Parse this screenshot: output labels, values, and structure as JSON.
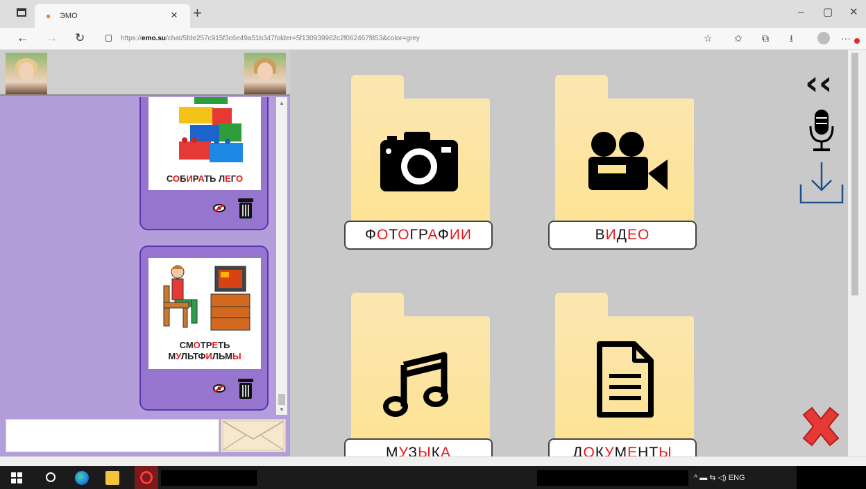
{
  "browser": {
    "tab_title": "ЭМО",
    "url_prefix": "https://",
    "url_domain": "emo.su",
    "url_path": "/chat/5fde257c915f3c6e49a51b347folder=5f130939962c2f062467f853&color=grey",
    "tab_close": "×",
    "new_tab": "+",
    "window": {
      "minimize": "–",
      "maximize": "▢",
      "close": "✕"
    },
    "nav": {
      "back": "←",
      "forward": "→",
      "reload": "↻"
    },
    "toolbar_icons": {
      "reading": "☆",
      "favorites": "✩",
      "collections": "⧉",
      "downloads": "⭳",
      "more": "···"
    }
  },
  "left_panel": {
    "cards": [
      {
        "label_parts": [
          {
            "t": "С",
            "r": false
          },
          {
            "t": "О",
            "r": true
          },
          {
            "t": "Б",
            "r": false
          },
          {
            "t": "И",
            "r": true
          },
          {
            "t": "Р",
            "r": false
          },
          {
            "t": "А",
            "r": true
          },
          {
            "t": "ТЬ Л",
            "r": false
          },
          {
            "t": "Е",
            "r": true
          },
          {
            "t": "Г",
            "r": false
          },
          {
            "t": "О",
            "r": true
          }
        ]
      },
      {
        "label_line1": [
          {
            "t": "СМ",
            "r": false
          },
          {
            "t": "О",
            "r": true
          },
          {
            "t": "ТР",
            "r": false
          },
          {
            "t": "Е",
            "r": true
          },
          {
            "t": "ТЬ",
            "r": false
          }
        ],
        "label_line2": [
          {
            "t": "М",
            "r": false
          },
          {
            "t": "У",
            "r": true
          },
          {
            "t": "ЛЬТФ",
            "r": false
          },
          {
            "t": "И",
            "r": true
          },
          {
            "t": "ЛЬМ",
            "r": false
          },
          {
            "t": "Ы",
            "r": true
          }
        ]
      }
    ]
  },
  "folders": [
    {
      "icon": "camera-icon",
      "label_parts": [
        {
          "t": "Ф",
          "r": false
        },
        {
          "t": "О",
          "r": true
        },
        {
          "t": "Т",
          "r": false
        },
        {
          "t": "О",
          "r": true
        },
        {
          "t": "ГР",
          "r": false
        },
        {
          "t": "А",
          "r": true
        },
        {
          "t": "Ф",
          "r": false
        },
        {
          "t": "ИИ",
          "r": true
        }
      ]
    },
    {
      "icon": "video-camera-icon",
      "label_parts": [
        {
          "t": "В",
          "r": false
        },
        {
          "t": "И",
          "r": true
        },
        {
          "t": "Д",
          "r": false
        },
        {
          "t": "Е",
          "r": true
        },
        {
          "t": "О",
          "r": true
        }
      ]
    },
    {
      "icon": "music-note-icon",
      "label_parts": [
        {
          "t": "М",
          "r": false
        },
        {
          "t": "У",
          "r": true
        },
        {
          "t": "З",
          "r": false
        },
        {
          "t": "Ы",
          "r": true
        },
        {
          "t": "К",
          "r": false
        },
        {
          "t": "А",
          "r": true
        }
      ]
    },
    {
      "icon": "document-icon",
      "label_parts": [
        {
          "t": "Д",
          "r": false
        },
        {
          "t": "О",
          "r": true
        },
        {
          "t": "К",
          "r": false
        },
        {
          "t": "У",
          "r": true
        },
        {
          "t": "М",
          "r": false
        },
        {
          "t": "Е",
          "r": true
        },
        {
          "t": "НТ",
          "r": false
        },
        {
          "t": "Ы",
          "r": true
        }
      ]
    }
  ],
  "side_controls": {
    "collapse": "‹‹"
  },
  "taskbar": {
    "tray_text": "^  ▬  ⇆  ◁)  ENG"
  },
  "colors": {
    "accent_red": "#e8171b",
    "panel_purple": "#b39ddb",
    "card_purple": "#9575cd",
    "folder_yellow": "#fde394"
  }
}
